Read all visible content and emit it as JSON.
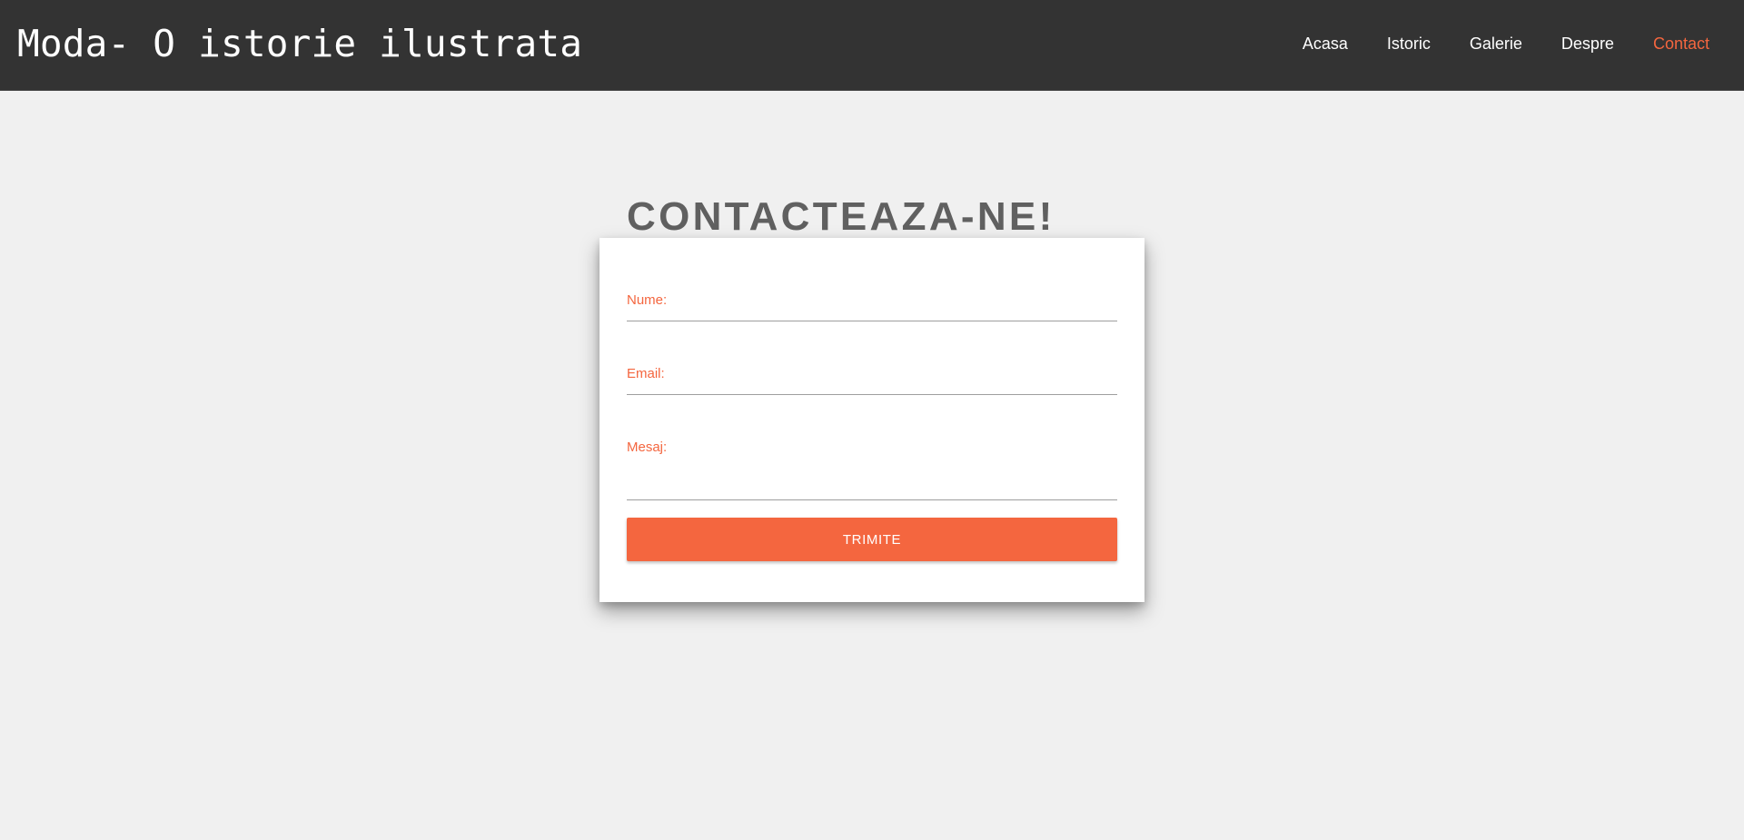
{
  "header": {
    "title": "Moda- O istorie ilustrata",
    "nav": [
      {
        "label": "Acasa",
        "active": false
      },
      {
        "label": "Istoric",
        "active": false
      },
      {
        "label": "Galerie",
        "active": false
      },
      {
        "label": "Despre",
        "active": false
      },
      {
        "label": "Contact",
        "active": true
      }
    ]
  },
  "contact": {
    "heading": "CONTACTEAZA-NE!",
    "fields": {
      "name": {
        "label": "Nume:",
        "value": ""
      },
      "email": {
        "label": "Email:",
        "value": ""
      },
      "message": {
        "label": "Mesaj:",
        "value": ""
      }
    },
    "submit_label": "TRIMITE"
  },
  "colors": {
    "header_bg": "#333333",
    "page_bg": "#f0f0f0",
    "accent": "#f4663f",
    "heading": "#606060"
  }
}
